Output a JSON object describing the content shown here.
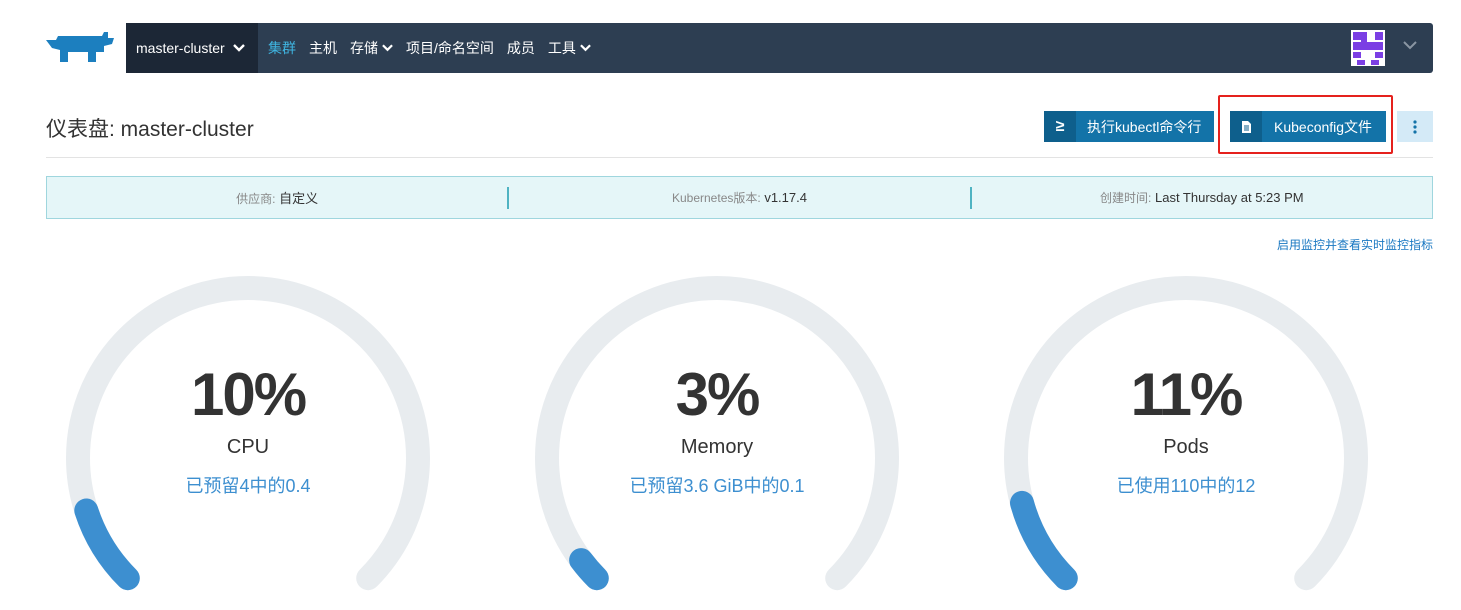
{
  "nav": {
    "cluster": "master-cluster",
    "items": [
      {
        "label": "集群",
        "dropdown": false,
        "active": true
      },
      {
        "label": "主机",
        "dropdown": false
      },
      {
        "label": "存储",
        "dropdown": true
      },
      {
        "label": "项目/命名空间",
        "dropdown": false
      },
      {
        "label": "成员",
        "dropdown": false
      },
      {
        "label": "工具",
        "dropdown": true
      }
    ]
  },
  "page": {
    "title": "仪表盘: master-cluster",
    "kubectl_label": "执行kubectl命令行",
    "kubectl_icon": "≥",
    "kubeconfig_label": "Kubeconfig文件"
  },
  "info": {
    "provider_key": "供应商:",
    "provider_value": "自定义",
    "k8s_key": "Kubernetes版本:",
    "k8s_value": "v1.17.4",
    "created_key": "创建时间:",
    "created_value": "Last Thursday at 5:23 PM"
  },
  "monitor_link": "启用监控并查看实时监控指标",
  "gauges": [
    {
      "value": "10%",
      "name": "CPU",
      "detail": "已预留4中的0.4",
      "fraction": 0.1
    },
    {
      "value": "3%",
      "name": "Memory",
      "detail": "已预留3.6  GiB中的0.1",
      "fraction": 0.03
    },
    {
      "value": "11%",
      "name": "Pods",
      "detail": "已使用110中的12",
      "fraction": 0.11
    }
  ],
  "colors": {
    "nav_bg": "#2d3e52",
    "nav_active": "#3fb4e0",
    "primary_button": "#1373a8",
    "gauge_track": "#e8ecef",
    "gauge_fill": "#3d8fd0",
    "highlight": "#e5211d"
  }
}
